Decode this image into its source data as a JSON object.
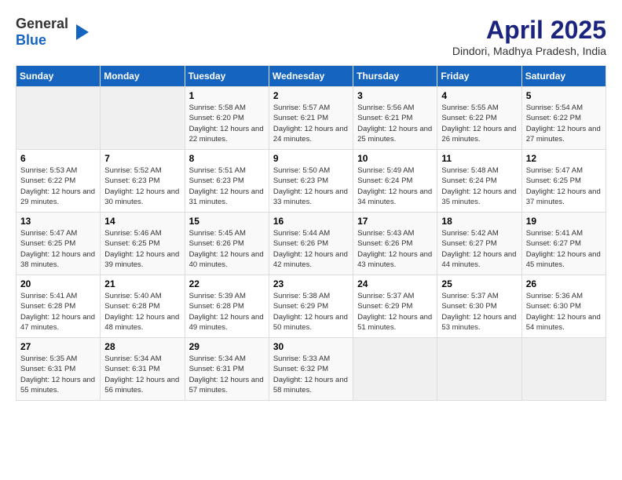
{
  "header": {
    "logo_general": "General",
    "logo_blue": "Blue",
    "title": "April 2025",
    "subtitle": "Dindori, Madhya Pradesh, India"
  },
  "calendar": {
    "days_of_week": [
      "Sunday",
      "Monday",
      "Tuesday",
      "Wednesday",
      "Thursday",
      "Friday",
      "Saturday"
    ],
    "weeks": [
      [
        {
          "num": "",
          "info": ""
        },
        {
          "num": "",
          "info": ""
        },
        {
          "num": "1",
          "info": "Sunrise: 5:58 AM\nSunset: 6:20 PM\nDaylight: 12 hours and 22 minutes."
        },
        {
          "num": "2",
          "info": "Sunrise: 5:57 AM\nSunset: 6:21 PM\nDaylight: 12 hours and 24 minutes."
        },
        {
          "num": "3",
          "info": "Sunrise: 5:56 AM\nSunset: 6:21 PM\nDaylight: 12 hours and 25 minutes."
        },
        {
          "num": "4",
          "info": "Sunrise: 5:55 AM\nSunset: 6:22 PM\nDaylight: 12 hours and 26 minutes."
        },
        {
          "num": "5",
          "info": "Sunrise: 5:54 AM\nSunset: 6:22 PM\nDaylight: 12 hours and 27 minutes."
        }
      ],
      [
        {
          "num": "6",
          "info": "Sunrise: 5:53 AM\nSunset: 6:22 PM\nDaylight: 12 hours and 29 minutes."
        },
        {
          "num": "7",
          "info": "Sunrise: 5:52 AM\nSunset: 6:23 PM\nDaylight: 12 hours and 30 minutes."
        },
        {
          "num": "8",
          "info": "Sunrise: 5:51 AM\nSunset: 6:23 PM\nDaylight: 12 hours and 31 minutes."
        },
        {
          "num": "9",
          "info": "Sunrise: 5:50 AM\nSunset: 6:23 PM\nDaylight: 12 hours and 33 minutes."
        },
        {
          "num": "10",
          "info": "Sunrise: 5:49 AM\nSunset: 6:24 PM\nDaylight: 12 hours and 34 minutes."
        },
        {
          "num": "11",
          "info": "Sunrise: 5:48 AM\nSunset: 6:24 PM\nDaylight: 12 hours and 35 minutes."
        },
        {
          "num": "12",
          "info": "Sunrise: 5:47 AM\nSunset: 6:25 PM\nDaylight: 12 hours and 37 minutes."
        }
      ],
      [
        {
          "num": "13",
          "info": "Sunrise: 5:47 AM\nSunset: 6:25 PM\nDaylight: 12 hours and 38 minutes."
        },
        {
          "num": "14",
          "info": "Sunrise: 5:46 AM\nSunset: 6:25 PM\nDaylight: 12 hours and 39 minutes."
        },
        {
          "num": "15",
          "info": "Sunrise: 5:45 AM\nSunset: 6:26 PM\nDaylight: 12 hours and 40 minutes."
        },
        {
          "num": "16",
          "info": "Sunrise: 5:44 AM\nSunset: 6:26 PM\nDaylight: 12 hours and 42 minutes."
        },
        {
          "num": "17",
          "info": "Sunrise: 5:43 AM\nSunset: 6:26 PM\nDaylight: 12 hours and 43 minutes."
        },
        {
          "num": "18",
          "info": "Sunrise: 5:42 AM\nSunset: 6:27 PM\nDaylight: 12 hours and 44 minutes."
        },
        {
          "num": "19",
          "info": "Sunrise: 5:41 AM\nSunset: 6:27 PM\nDaylight: 12 hours and 45 minutes."
        }
      ],
      [
        {
          "num": "20",
          "info": "Sunrise: 5:41 AM\nSunset: 6:28 PM\nDaylight: 12 hours and 47 minutes."
        },
        {
          "num": "21",
          "info": "Sunrise: 5:40 AM\nSunset: 6:28 PM\nDaylight: 12 hours and 48 minutes."
        },
        {
          "num": "22",
          "info": "Sunrise: 5:39 AM\nSunset: 6:28 PM\nDaylight: 12 hours and 49 minutes."
        },
        {
          "num": "23",
          "info": "Sunrise: 5:38 AM\nSunset: 6:29 PM\nDaylight: 12 hours and 50 minutes."
        },
        {
          "num": "24",
          "info": "Sunrise: 5:37 AM\nSunset: 6:29 PM\nDaylight: 12 hours and 51 minutes."
        },
        {
          "num": "25",
          "info": "Sunrise: 5:37 AM\nSunset: 6:30 PM\nDaylight: 12 hours and 53 minutes."
        },
        {
          "num": "26",
          "info": "Sunrise: 5:36 AM\nSunset: 6:30 PM\nDaylight: 12 hours and 54 minutes."
        }
      ],
      [
        {
          "num": "27",
          "info": "Sunrise: 5:35 AM\nSunset: 6:31 PM\nDaylight: 12 hours and 55 minutes."
        },
        {
          "num": "28",
          "info": "Sunrise: 5:34 AM\nSunset: 6:31 PM\nDaylight: 12 hours and 56 minutes."
        },
        {
          "num": "29",
          "info": "Sunrise: 5:34 AM\nSunset: 6:31 PM\nDaylight: 12 hours and 57 minutes."
        },
        {
          "num": "30",
          "info": "Sunrise: 5:33 AM\nSunset: 6:32 PM\nDaylight: 12 hours and 58 minutes."
        },
        {
          "num": "",
          "info": ""
        },
        {
          "num": "",
          "info": ""
        },
        {
          "num": "",
          "info": ""
        }
      ]
    ]
  }
}
